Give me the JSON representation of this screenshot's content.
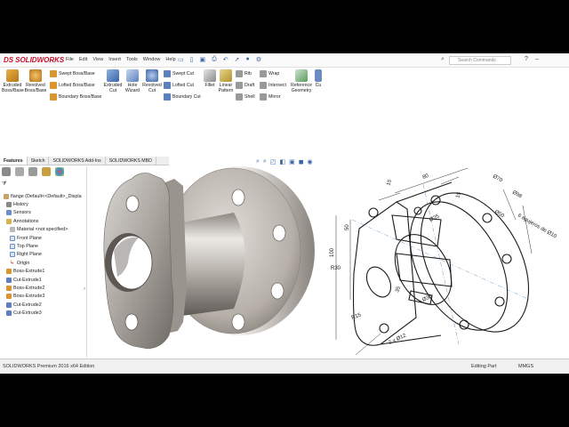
{
  "app": {
    "brand": "SOLIDWORKS",
    "brand_mark": "DS"
  },
  "menus": [
    "File",
    "Edit",
    "View",
    "Insert",
    "Tools",
    "Window",
    "Help"
  ],
  "search": {
    "placeholder": "Search Commands"
  },
  "ribbon": {
    "extruded_boss": "Extruded Boss/Base",
    "revolved_boss": "Revolved Boss/Base",
    "swept_boss": "Swept Boss/Base",
    "lofted_boss": "Lofted Boss/Base",
    "boundary_boss": "Boundary Boss/Base",
    "extruded_cut": "Extruded Cut",
    "hole_wizard": "Hole Wizard",
    "revolved_cut": "Revolved Cut",
    "swept_cut": "Swept Cut",
    "lofted_cut": "Lofted Cut",
    "boundary_cut": "Boundary Cut",
    "fillet": "Fillet",
    "linear_pattern": "Linear Pattern",
    "rib": "Rib",
    "draft": "Draft",
    "shell": "Shell",
    "wrap": "Wrap",
    "intersect": "Intersect",
    "mirror": "Mirror",
    "reference_geometry": "Reference Geometry",
    "curves": "Cu"
  },
  "command_tabs": [
    "Features",
    "Sketch",
    "SOLIDWORKS Add-Ins",
    "SOLIDWORKS MBD"
  ],
  "tree": {
    "root": "flange (Default<<Default>_Displa",
    "items": [
      "History",
      "Sensors",
      "Annotations",
      "Material <not specified>",
      "Front Plane",
      "Top Plane",
      "Right Plane",
      "Origin",
      "Boss-Extrude1",
      "Cut-Extrude1",
      "Boss-Extrude2",
      "Boss-Extrude3",
      "Cut-Extrude2",
      "Cut-Extrude3"
    ]
  },
  "drawing": {
    "dims": [
      "80",
      "15",
      "15",
      "Ø70",
      "Ø98",
      "Ø25",
      "Ø50",
      "6 agujeros de Ø10",
      "50",
      "100",
      "R30",
      "35",
      "Ø35",
      "R15",
      "2 x Ø12"
    ]
  },
  "status": {
    "left": "SOLIDWORKS Premium 2016 x64 Edition",
    "mode": "Editing Part",
    "units": "MMGS"
  },
  "colors": {
    "brand": "#c8102e",
    "icon_blue": "#3a64a8",
    "metal": "#b9b4ae"
  }
}
